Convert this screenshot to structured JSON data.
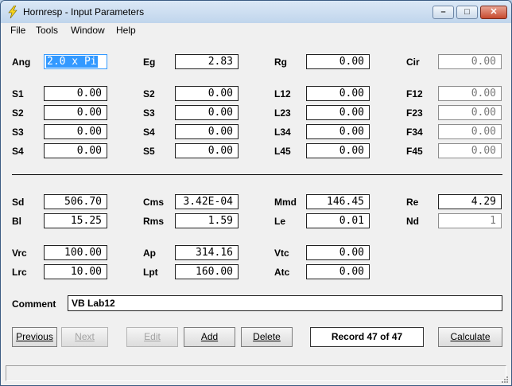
{
  "window": {
    "title": "Hornresp - Input Parameters"
  },
  "menu": [
    "File",
    "Tools",
    "Window",
    "Help"
  ],
  "top_section": [
    [
      {
        "label": "Ang",
        "value": "2.0 x Pi",
        "state": "selected"
      },
      {
        "label": "Eg",
        "value": "2.83"
      },
      {
        "label": "Rg",
        "value": "0.00"
      },
      {
        "label": "Cir",
        "value": "0.00",
        "state": "dim"
      }
    ],
    [
      {
        "label": "S1",
        "value": "0.00"
      },
      {
        "label": "S2",
        "value": "0.00"
      },
      {
        "label": "L12",
        "value": "0.00"
      },
      {
        "label": "F12",
        "value": "0.00",
        "state": "dim"
      }
    ],
    [
      {
        "label": "S2",
        "value": "0.00"
      },
      {
        "label": "S3",
        "value": "0.00"
      },
      {
        "label": "L23",
        "value": "0.00"
      },
      {
        "label": "F23",
        "value": "0.00",
        "state": "dim"
      }
    ],
    [
      {
        "label": "S3",
        "value": "0.00"
      },
      {
        "label": "S4",
        "value": "0.00"
      },
      {
        "label": "L34",
        "value": "0.00"
      },
      {
        "label": "F34",
        "value": "0.00",
        "state": "dim"
      }
    ],
    [
      {
        "label": "S4",
        "value": "0.00"
      },
      {
        "label": "S5",
        "value": "0.00"
      },
      {
        "label": "L45",
        "value": "0.00"
      },
      {
        "label": "F45",
        "value": "0.00",
        "state": "dim"
      }
    ]
  ],
  "driver_section": [
    [
      {
        "label": "Sd",
        "value": "506.70"
      },
      {
        "label": "Cms",
        "value": "3.42E-04"
      },
      {
        "label": "Mmd",
        "value": "146.45"
      },
      {
        "label": "Re",
        "value": "4.29"
      }
    ],
    [
      {
        "label": "Bl",
        "value": "15.25"
      },
      {
        "label": "Rms",
        "value": "1.59"
      },
      {
        "label": "Le",
        "value": "0.01"
      },
      {
        "label": "Nd",
        "value": "1",
        "state": "dim"
      }
    ]
  ],
  "chamber_section": [
    [
      {
        "label": "Vrc",
        "value": "100.00"
      },
      {
        "label": "Ap",
        "value": "314.16"
      },
      {
        "label": "Vtc",
        "value": "0.00"
      }
    ],
    [
      {
        "label": "Lrc",
        "value": "10.00"
      },
      {
        "label": "Lpt",
        "value": "160.00"
      },
      {
        "label": "Atc",
        "value": "0.00"
      }
    ]
  ],
  "comment": {
    "label": "Comment",
    "value": "VB Lab12"
  },
  "buttons": {
    "previous": "Previous",
    "next": "Next",
    "edit": "Edit",
    "add": "Add",
    "delete": "Delete",
    "calculate": "Calculate"
  },
  "record_status": "Record 47 of 47",
  "colors": {
    "selection": "#3399ff",
    "disabled_text": "#a3a3a3"
  }
}
